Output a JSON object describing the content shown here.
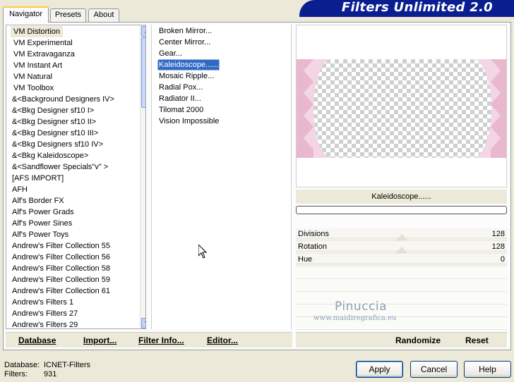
{
  "title": "Filters Unlimited 2.0",
  "tabs": [
    "Navigator",
    "Presets",
    "About"
  ],
  "categories": [
    "VM Distortion",
    "VM Experimental",
    "VM Extravaganza",
    "VM Instant Art",
    "VM Natural",
    "VM Toolbox",
    "&<Background Designers IV>",
    "&<Bkg Designer sf10 I>",
    "&<Bkg Designer sf10 II>",
    "&<Bkg Designer sf10 III>",
    "&<Bkg Designers sf10 IV>",
    "&<Bkg Kaleidoscope>",
    "&<Sandflower Specials\"v\" >",
    "[AFS IMPORT]",
    "AFH",
    "Alf's Border FX",
    "Alf's Power Grads",
    "Alf's Power Sines",
    "Alf's Power Toys",
    "Andrew's Filter Collection 55",
    "Andrew's Filter Collection 56",
    "Andrew's Filter Collection 58",
    "Andrew's Filter Collection 59",
    "Andrew's Filter Collection 61",
    "Andrew's Filters 1",
    "Andrew's Filters 27",
    "Andrew's Filters 29"
  ],
  "selected_category_index": 0,
  "filters": [
    "Broken Mirror...",
    "Center Mirror...",
    "Gear...",
    "Kaleidoscope......",
    "Mosaic Ripple...",
    "Radial Pox...",
    "Radiator II...",
    "Tilomat 2000",
    "Vision Impossible"
  ],
  "selected_filter_index": 3,
  "current_filter_name": "Kaleidoscope......",
  "progress_fraction": 0.0,
  "params": [
    {
      "label": "Divisions",
      "value": "128"
    },
    {
      "label": "Rotation",
      "value": "128"
    },
    {
      "label": "Hue",
      "value": "0"
    }
  ],
  "watermark": {
    "line1": "Pinuccia",
    "line2": "www.maidiregrafica.eu"
  },
  "bottom_left_buttons": [
    "Database",
    "Import...",
    "Filter Info...",
    "Editor..."
  ],
  "bottom_right_buttons": [
    "Randomize",
    "Reset"
  ],
  "info": {
    "database_label": "Database:",
    "database_value": "ICNET-Filters",
    "filters_label": "Filters:",
    "filters_value": "931"
  },
  "dialog_buttons": {
    "apply": "Apply",
    "cancel": "Cancel",
    "help": "Help"
  },
  "colors": {
    "title_banner": "#0a1f8f",
    "selection": "#316ac5",
    "preview_pink": "#f3d6e4"
  }
}
